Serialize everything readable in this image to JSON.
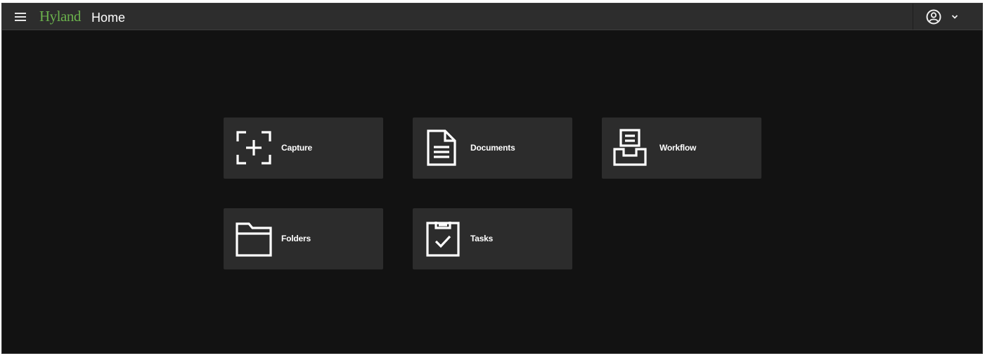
{
  "header": {
    "brand": "Hyland",
    "title": "Home",
    "menu_icon": "hamburger-icon",
    "user_icon": "user-circle-icon",
    "chevron_icon": "chevron-down-icon"
  },
  "colors": {
    "brand_green": "#6ab04c",
    "background": "#121212",
    "header": "#2d2d2d",
    "tile": "#2c2c2c",
    "text": "#ffffff"
  },
  "tiles": [
    {
      "label": "Capture",
      "icon": "capture-icon"
    },
    {
      "label": "Documents",
      "icon": "document-icon"
    },
    {
      "label": "Workflow",
      "icon": "inbox-tray-icon"
    },
    {
      "label": "Folders",
      "icon": "folder-icon"
    },
    {
      "label": "Tasks",
      "icon": "clipboard-check-icon"
    }
  ]
}
